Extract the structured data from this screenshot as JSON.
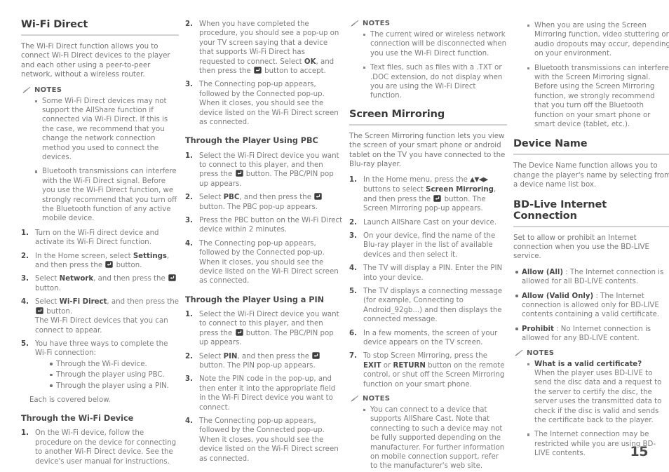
{
  "page": {
    "number": "15",
    "icons": {
      "notes": "pencil-icon",
      "enter_button": "enter-button-icon",
      "direction_buttons": "▲▼◀▶"
    }
  },
  "col1": {
    "heading": "Wi-Fi Direct",
    "intro": "The Wi-Fi Direct function allows you to connect Wi-Fi Direct devices to the player and each other using a peer-to-peer network, without a wireless router.",
    "notes_label": "NOTES",
    "notes": [
      "Some Wi-Fi Direct devices may not support the AllShare function if connected via Wi-Fi Direct. If this is the case, we recommend that you change the network connection method you used to connect the devices.",
      "Bluetooth transmissions can interfere with the Wi-Fi Direct signal. Before you use the Wi-Fi Direct function, we strongly recommend that you turn off the Bluetooth function of any active mobile device."
    ],
    "steps": [
      "Turn on the Wi-Fi direct device and activate its Wi-Fi Direct function.",
      "In the Home screen, select Settings, and then press the  button.",
      "Select Network, and then press the  button.",
      "Select Wi-Fi Direct, and then press the  button. The Wi-Fi Direct devices that you can connect to appear.",
      "You have three ways to complete the Wi-Fi connection:"
    ],
    "step2_bold": "Settings",
    "step3_bold": "Network",
    "step4_bold": "Wi-Fi Direct",
    "step4_extra": "The Wi-Fi Direct devices that you can connect to appear.",
    "ways": [
      "Through the Wi-Fi device.",
      "Through the player using PBC.",
      "Through the player using a PIN."
    ],
    "ways_footer": "Each is covered below.",
    "subheading": "Through the Wi-Fi Device",
    "sub_steps": [
      "On the Wi-Fi device, follow the procedure on the device for connecting to another Wi-Fi Direct device. See the device's user manual for instructions."
    ]
  },
  "col2": {
    "step2": {
      "text_a": "When you have completed the procedure, you should see a pop-up on your TV screen saying that a device that supports Wi-Fi Direct has requested to connect. Select ",
      "bold": "OK",
      "text_b": ", and then press the ",
      "text_c": " button to accept."
    },
    "step3": "The Connecting pop-up appears, followed by the Connected pop-up. When it closes, you should see the device listed on the Wi-Fi Direct screen as connected.",
    "subheading_pbc": "Through the Player Using PBC",
    "pbc_steps": {
      "s1_a": "Select the Wi-Fi Direct device you want to connect to this player, and then press the ",
      "s1_b": " button. The PBC/PIN pop up appears.",
      "s2_a": "Select ",
      "s2_bold": "PBC",
      "s2_b": ", and then press the ",
      "s2_c": " button. The PBC pop-up appears.",
      "s3": "Press the PBC button on the Wi-Fi Direct device within 2 minutes.",
      "s4": "The Connecting pop-up appears, followed by the Connected pop-up. When it closes, you should see the device listed on the Wi-Fi Direct screen as connected."
    },
    "subheading_pin": "Through the Player Using a PIN",
    "pin_steps": {
      "s1_a": "Select the Wi-Fi Direct device you want to connect to this player, and then press the ",
      "s1_b": " button. The PBC/PIN pop up appears.",
      "s2_a": "Select ",
      "s2_bold": "PIN",
      "s2_b": ", and then press the ",
      "s2_c": " button. The PIN pop-up appears.",
      "s3": "Note the PIN code in the pop-up, and then enter it into the appropriate field in the Wi-Fi Direct device you want to connect.",
      "s4": "The Connecting pop-up appears, followed by the Connected pop-up. When it closes, you should see the device listed on the Wi-Fi Direct screen as connected."
    }
  },
  "col3": {
    "notes_label": "NOTES",
    "notes": [
      "The current wired or wireless network connection will be disconnected when you use the Wi-Fi Direct function.",
      "Text files, such as files with a .TXT or .DOC extension, do not display when you are using the Wi-Fi Direct function."
    ],
    "heading": "Screen Mirroring",
    "intro": "The Screen Mirroring function lets you view the screen of your smart phone or android tablet on the TV you have connected to the Blu-ray player.",
    "step1": {
      "a": "In the Home menu, press the ",
      "arrows": "▲▼◀▶",
      "b": " buttons to select ",
      "bold": "Screen Mirroring",
      "c": ", and then press the ",
      "d": " button. The Screen Mirroring pop-up appears."
    },
    "step2": "Launch AllShare Cast on your device.",
    "step3": "On your device, find the name of the Blu-ray player in the list of available devices and then select it.",
    "step4": "The TV will display a PIN. Enter the PIN into your device.",
    "step5": "The TV displays a connecting message (for example, Connecting to Android_92gb...) and then displays the connected message.",
    "step6": "In a few moments, the screen of your device appears on the TV screen.",
    "step7": {
      "a": "To stop Screen Mirroring, press the ",
      "bold1": "EXIT",
      "b": " or ",
      "bold2": "RETURN",
      "c": " button on the remote control, or shut off the Screen Mirroring function on your smart phone."
    },
    "notes2_label": "NOTES",
    "notes2": [
      "You can connect to a device that supports AllShare Cast. Note that connecting to such a device may not be fully supported depending on the manufacturer. For further information on mobile connection support, refer to the manufacturer's web site."
    ]
  },
  "col4": {
    "notes": [
      "When you are using the Screen Mirroring function, video stuttering or audio dropouts may occur, depending on your environment.",
      "Bluetooth transmissions can interfere with the Screen Mirroring signal. Before using the Screen Mirroring function, we strongly recommend that you turn off the Bluetooth function on your smart phone or smart device (tablet, etc.)."
    ],
    "heading_device": "Device Name",
    "device_intro": "The Device Name function allows you to change the player's name by selecting from a device name list box.",
    "heading_bdlive": "BD-Live Internet Connection",
    "bdlive_intro": "Set to allow or prohibit an Internet connection when you use the BD-LIVE service.",
    "options": [
      {
        "bold": "Allow (All)",
        "text": " : The Internet connection is allowed for all BD-LIVE contents."
      },
      {
        "bold": "Allow (Valid Only)",
        "text": " : The Internet connection is allowed only for BD-LIVE contents containing a valid certificate."
      },
      {
        "bold": "Prohibit",
        "text": " : No Internet connection is allowed for any BD-LIVE content."
      }
    ],
    "notes_label": "NOTES",
    "note_q_bold": "What is a valid certificate?",
    "note_q_text": "When the player uses BD-LIVE to send the disc data and a request to the server to certify the disc, the server uses the transmitted data to check if the disc is valid and sends the certificate back to the player.",
    "note_last": "The Internet connection may be restricted while you are using BD-LIVE contents."
  }
}
